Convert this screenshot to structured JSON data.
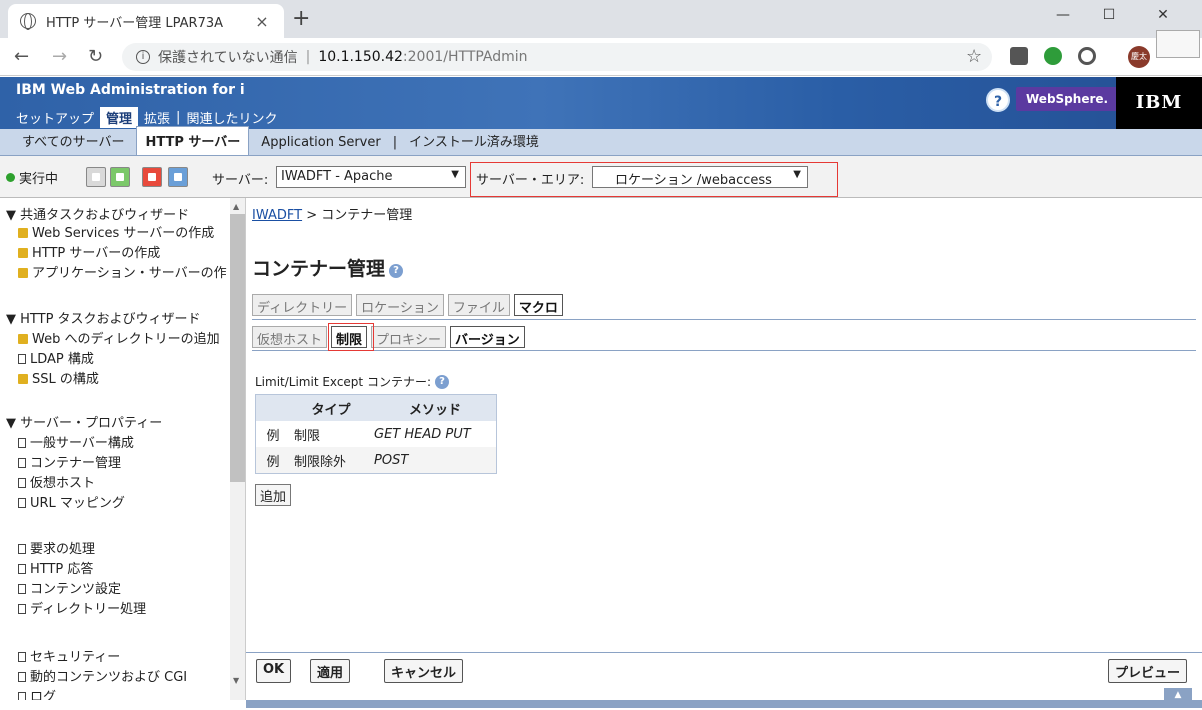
{
  "browser": {
    "tab_title": "HTTP サーバー管理 LPAR73A",
    "tab_close": "×",
    "new_tab": "+",
    "min": "—",
    "max": "☐",
    "close": "✕",
    "security_label": "保護されていない通信",
    "separator": "|",
    "url_host": "10.1.150.42",
    "url_path": ":2001/HTTPAdmin",
    "avatar_text": "慶太"
  },
  "header": {
    "app_title": "IBM Web Administration for i",
    "nav": [
      "セットアップ",
      "管理",
      "拡張",
      "関連したリンク"
    ],
    "divider": "|",
    "help_glyph": "?",
    "websphere": "WebSphere.",
    "ibm": "IBM"
  },
  "subnav": {
    "items": [
      "すべてのサーバー",
      "HTTP サーバー",
      "Application Server",
      "インストール済み環境"
    ],
    "divider": "|"
  },
  "toolbar": {
    "status": "実行中",
    "server_label": "サーバー:",
    "server_value": "IWADFT - Apache",
    "area_label": "サーバー・エリア:",
    "area_value": "ロケーション /webaccess",
    "arrow": "▼"
  },
  "sidebar": {
    "groups": [
      {
        "title": "共通タスクおよびウィザード",
        "items": [
          "Web Services サーバーの作成",
          "HTTP サーバーの作成",
          "アプリケーション・サーバーの作"
        ]
      },
      {
        "title": "HTTP タスクおよびウィザード",
        "items": [
          "Web へのディレクトリーの追加",
          "LDAP 構成",
          "SSL の構成"
        ]
      },
      {
        "title": "サーバー・プロパティー",
        "items": [
          "一般サーバー構成",
          "コンテナー管理",
          "仮想ホスト",
          "URL マッピング"
        ]
      }
    ],
    "more_items": [
      "要求の処理",
      "HTTP 応答",
      "コンテンツ設定",
      "ディレクトリー処理"
    ],
    "more_items2": [
      "セキュリティー",
      "動的コンテンツおよび CGI",
      "ログ"
    ],
    "toggle": "▼"
  },
  "main": {
    "breadcrumb_link": "IWADFT",
    "breadcrumb_rest": " > コンテナー管理",
    "title": "コンテナー管理",
    "help": "?",
    "tabs1": [
      "ディレクトリー",
      "ロケーション",
      "ファイル",
      "マクロ"
    ],
    "tabs2": [
      "仮想ホスト",
      "制限",
      "プロキシー",
      "バージョン"
    ],
    "container_label": "Limit/Limit Except コンテナー:",
    "table": {
      "headers": [
        "",
        "タイプ",
        "メソッド"
      ],
      "rows": [
        [
          "例",
          "制限",
          "GET HEAD PUT"
        ],
        [
          "例",
          "制限除外",
          "POST"
        ]
      ]
    },
    "add_button": "追加"
  },
  "bottom": {
    "ok": "OK",
    "apply": "適用",
    "cancel": "キャンセル",
    "preview": "プレビュー"
  }
}
